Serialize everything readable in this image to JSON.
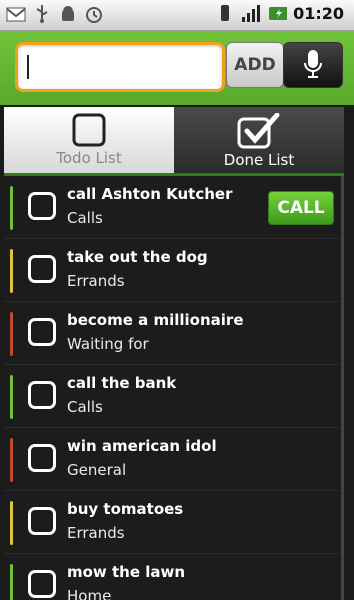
{
  "status_bar": {
    "time": "01:20",
    "left_icons": [
      "gmail-icon",
      "usb-icon",
      "android-debug-icon",
      "alarm-clock-icon"
    ],
    "right_icons": [
      "vibrate-icon",
      "signal-icon",
      "battery-charging-icon"
    ]
  },
  "toolbar": {
    "input_value": "",
    "add_label": "ADD",
    "mic_icon": "microphone-icon"
  },
  "tabs": [
    {
      "label": "Todo List",
      "icon": "empty-checkbox-icon",
      "selected": true
    },
    {
      "label": "Done List",
      "icon": "checked-checkbox-icon",
      "selected": false
    }
  ],
  "items": [
    {
      "title": "call Ashton Kutcher",
      "category": "Calls",
      "color": "#6fbf3b",
      "action": "CALL"
    },
    {
      "title": "take out the dog",
      "category": "Errands",
      "color": "#d8c63a"
    },
    {
      "title": "become a millionaire",
      "category": "Waiting for",
      "color": "#c44a2c"
    },
    {
      "title": "call the bank",
      "category": "Calls",
      "color": "#6fbf3b"
    },
    {
      "title": "win american idol",
      "category": "General",
      "color": "#c44a2c"
    },
    {
      "title": "buy tomatoes",
      "category": "Errands",
      "color": "#d8c63a"
    },
    {
      "title": "mow the lawn",
      "category": "Home",
      "color": "#6fbf3b"
    }
  ]
}
